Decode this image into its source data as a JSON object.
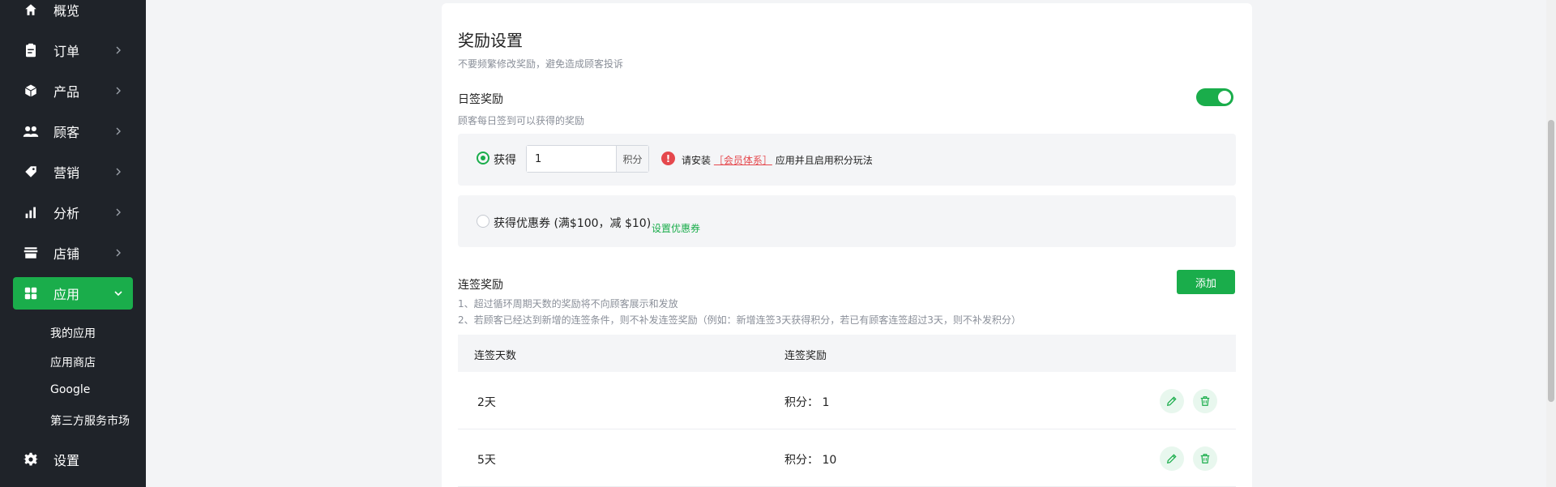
{
  "sidebar": {
    "items": [
      {
        "label": "概览",
        "icon": "home-icon"
      },
      {
        "label": "订单",
        "icon": "clipboard-icon"
      },
      {
        "label": "产品",
        "icon": "box-icon"
      },
      {
        "label": "顾客",
        "icon": "users-icon"
      },
      {
        "label": "营销",
        "icon": "tag-icon"
      },
      {
        "label": "分析",
        "icon": "bar-chart-icon"
      },
      {
        "label": "店铺",
        "icon": "store-icon"
      },
      {
        "label": "应用",
        "icon": "apps-icon",
        "active": true
      },
      {
        "label": "设置",
        "icon": "gear-icon"
      }
    ],
    "sub_items": [
      "我的应用",
      "应用商店",
      "Google",
      "第三方服务市场"
    ]
  },
  "reward": {
    "title": "奖励设置",
    "subtitle": "不要频繁修改奖励，避免造成顾客投诉",
    "daily": {
      "label": "日签奖励",
      "hint": "顾客每日签到可以获得的奖励",
      "enabled": true,
      "option_points": {
        "label": "获得",
        "value": "1",
        "unit": "积分",
        "selected": true,
        "warning_prefix": "请安装",
        "warning_link": "［会员体系］",
        "warning_suffix": "应用并且启用积分玩法"
      },
      "option_coupon": {
        "label": "获得优惠券 (满$100，减 $10)",
        "link": "设置优惠券",
        "selected": false
      }
    },
    "consecutive": {
      "label": "连签奖励",
      "note_1": "1、超过循环周期天数的奖励将不向顾客展示和发放",
      "note_2": "2、若顾客已经达到新增的连签条件，则不补发连签奖励（例如：新增连签3天获得积分，若已有顾客连签超过3天，则不补发积分）",
      "add_button": "添加",
      "columns": [
        "连签天数",
        "连签奖励"
      ],
      "rows": [
        {
          "days": "2天",
          "reward": "积分：  1"
        },
        {
          "days": "5天",
          "reward": "积分：  10"
        }
      ]
    }
  },
  "colors": {
    "brand": "#1aad4b",
    "sidebar_bg": "#1f2329",
    "warning": "#e5484d"
  }
}
